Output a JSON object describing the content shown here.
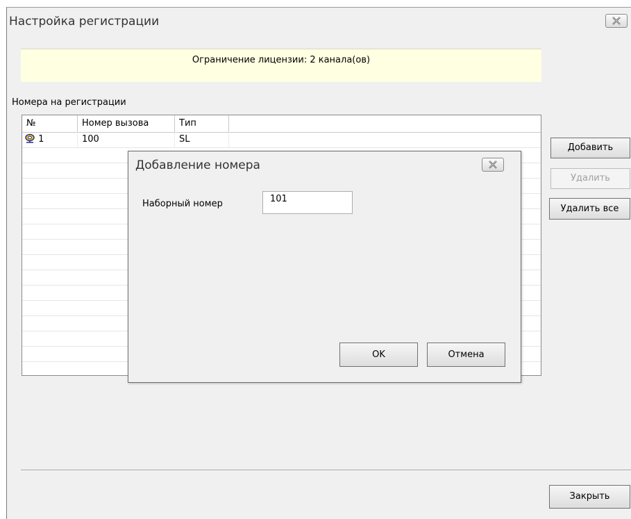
{
  "window": {
    "title": "Настройка регистрации"
  },
  "license_banner": "Ограничение лицензии: 2 канала(ов)",
  "registrations": {
    "label": "Номера на регистрации",
    "columns": [
      "№",
      "Номер вызова",
      "Тип"
    ],
    "rows": [
      {
        "num": "1",
        "number": "100",
        "type": "SL",
        "icon": "registration-status-icon"
      }
    ]
  },
  "buttons": {
    "add": "Добавить",
    "delete": "Удалить",
    "delete_all": "Удалить все",
    "close": "Закрыть"
  },
  "dialog": {
    "title": "Добавление номера",
    "field_label": "Наборный номер",
    "field_value": "101",
    "ok": "OK",
    "cancel": "Отмена"
  }
}
